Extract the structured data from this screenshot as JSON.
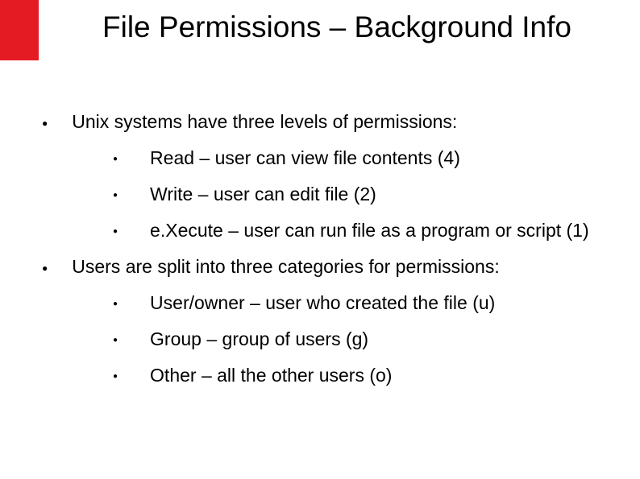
{
  "title": "File Permissions – Background Info",
  "sections": [
    {
      "heading": "Unix systems have three levels of permissions:",
      "items": [
        "Read – user can view file contents (4)",
        "Write – user can edit file (2)",
        "e.Xecute – user can run file as a program or script (1)"
      ]
    },
    {
      "heading": "Users are split into three categories for permissions:",
      "items": [
        "User/owner – user who created the file (u)",
        "Group – group of users (g)",
        "Other – all the other users (o)"
      ]
    }
  ]
}
